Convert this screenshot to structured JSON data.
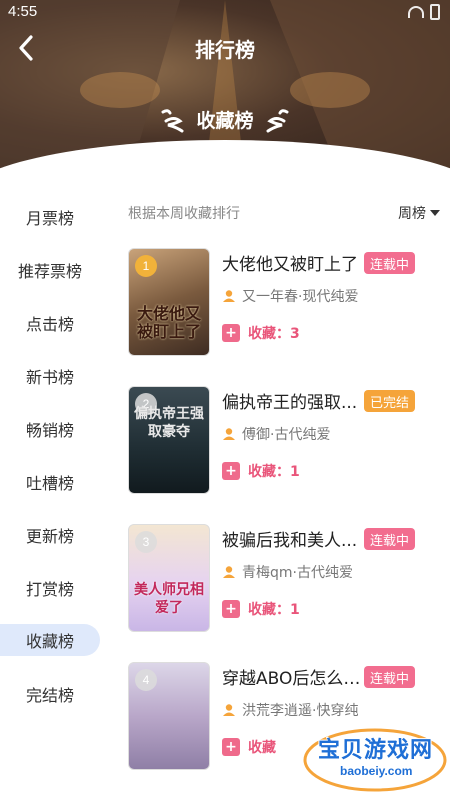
{
  "status": {
    "time": "4:55"
  },
  "nav": {
    "title": "排行榜"
  },
  "header": {
    "subtitle": "收藏榜"
  },
  "sidebar": {
    "items": [
      {
        "label": "月票榜"
      },
      {
        "label": "推荐票榜"
      },
      {
        "label": "点击榜"
      },
      {
        "label": "新书榜"
      },
      {
        "label": "畅销榜"
      },
      {
        "label": "吐槽榜"
      },
      {
        "label": "更新榜"
      },
      {
        "label": "打赏榜"
      },
      {
        "label": "收藏榜",
        "active": true
      },
      {
        "label": "完结榜"
      }
    ]
  },
  "list": {
    "caption": "根据本周收藏排行",
    "period": "周榜",
    "books": [
      {
        "rank": "1",
        "title": "大佬他又被盯上了",
        "status": "连载中",
        "status_color": "#f26d8f",
        "author": "又一年春·现代纯爱",
        "fav": "收藏：3",
        "cover_text": "大佬他又被盯上了"
      },
      {
        "rank": "2",
        "title": "偏执帝王的强取...",
        "status": "已完结",
        "status_color": "#f5a43a",
        "author": "傅御·古代纯爱",
        "fav": "收藏：1",
        "cover_text": "偏执帝王强取豪夺"
      },
      {
        "rank": "3",
        "title": "被骗后我和美人...",
        "status": "连载中",
        "status_color": "#f26d8f",
        "author": "青梅qm·古代纯爱",
        "fav": "收藏：1",
        "cover_text": "美人师兄相爱了"
      },
      {
        "rank": "4",
        "title": "穿越ABO后怎么剧...",
        "status": "连载中",
        "status_color": "#f26d8f",
        "author": "洪荒李逍遥·快穿纯",
        "fav": "收藏",
        "cover_text": ""
      }
    ]
  },
  "watermark": {
    "text": "宝贝游戏网",
    "url": "baobeiy.com"
  },
  "colors": {
    "accent": "#f26d8f",
    "active_bg": "#dfe9fb",
    "rank_gold": "#f1b23a"
  }
}
